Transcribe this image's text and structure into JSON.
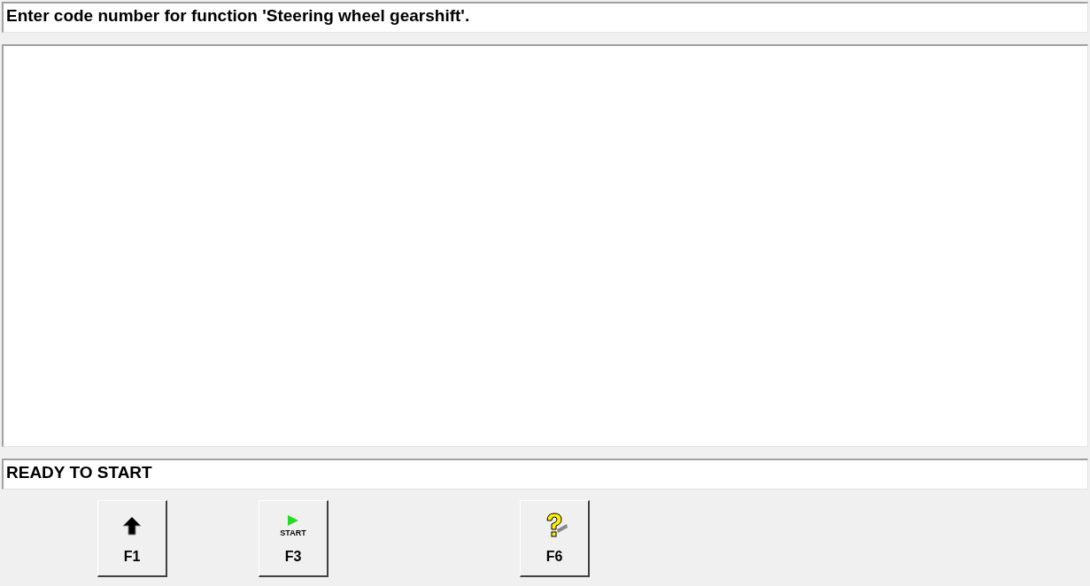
{
  "prompt": "Enter code number for function 'Steering wheel gearshift'.",
  "status": "READY TO START",
  "buttons": [
    {
      "key": "F1",
      "kind": "arrow"
    },
    {
      "key": "F3",
      "kind": "start",
      "caption": "START"
    },
    {
      "key": "F6",
      "kind": "help"
    }
  ]
}
